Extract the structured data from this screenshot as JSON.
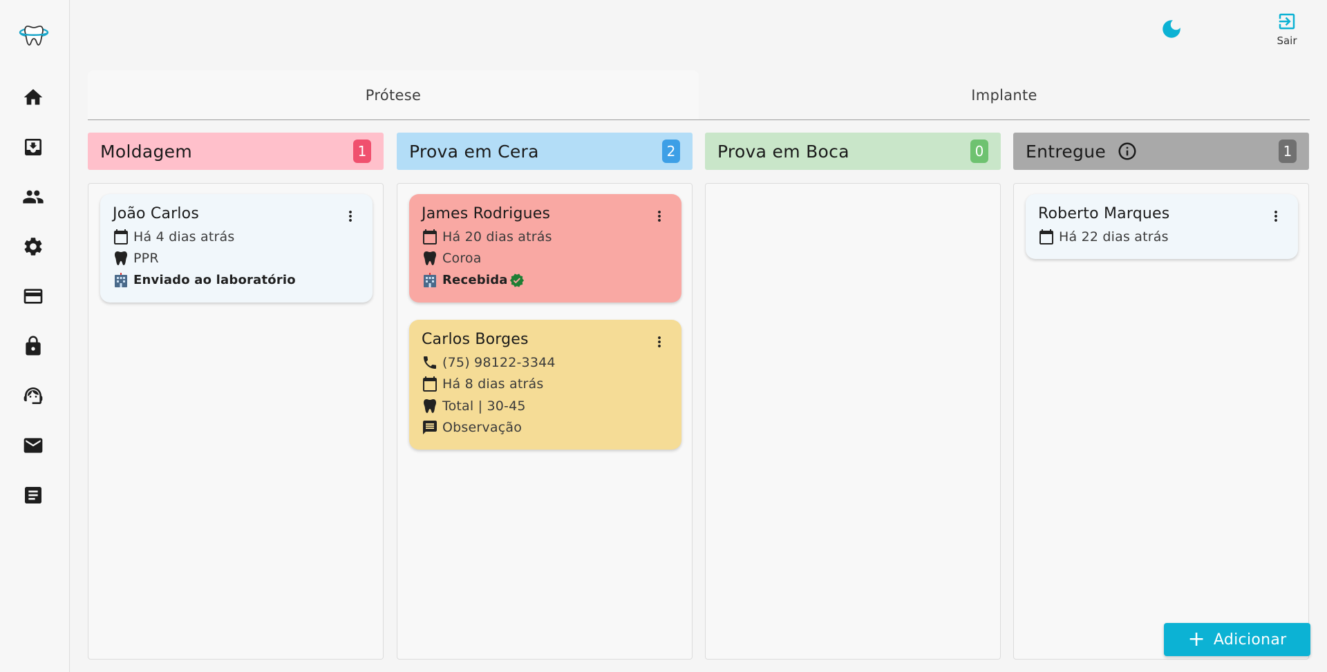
{
  "header": {
    "logout_label": "Sair"
  },
  "tabs": [
    {
      "label": "Prótese",
      "active": true
    },
    {
      "label": "Implante",
      "active": false
    }
  ],
  "sidebar": {
    "items": [
      {
        "icon": "home-icon"
      },
      {
        "icon": "archive-icon"
      },
      {
        "icon": "people-icon"
      },
      {
        "icon": "gear-icon"
      },
      {
        "icon": "credit-card-icon"
      },
      {
        "icon": "lock-icon"
      },
      {
        "icon": "headset-icon"
      },
      {
        "icon": "mail-icon"
      },
      {
        "icon": "document-icon"
      }
    ]
  },
  "columns": [
    {
      "title": "Moldagem",
      "count": "1",
      "color": "#ffc0cb",
      "badge_color": "#f0506e",
      "cards": [
        {
          "name": "João Carlos",
          "date": "Há 4 dias atrás",
          "type": "PPR",
          "lab_status": "Enviado ao laboratório",
          "color": "#f1f7fb"
        }
      ]
    },
    {
      "title": "Prova em Cera",
      "count": "2",
      "color": "#b3ddf7",
      "badge_color": "#3d9fe6",
      "cards": [
        {
          "name": "James Rodrigues",
          "date": "Há 20 dias atrás",
          "type": "Coroa",
          "lab_status": "Recebida",
          "color": "#f9a8a3"
        },
        {
          "name": "Carlos Borges",
          "phone": "(75) 98122-3344",
          "date": "Há 8 dias atrás",
          "type": "Total | 30-45",
          "note": "Observação",
          "color": "#f5dc96"
        }
      ]
    },
    {
      "title": "Prova em Boca",
      "count": "0",
      "color": "#c9e6c9",
      "badge_color": "#6ec270",
      "cards": []
    },
    {
      "title": "Entregue",
      "count": "1",
      "color": "#a9a9a9",
      "badge_color": "#707070",
      "cards": [
        {
          "name": "Roberto Marques",
          "date": "Há 22 dias atrás",
          "color": "#f1f7fb"
        }
      ]
    }
  ],
  "add_button_label": "Adicionar"
}
